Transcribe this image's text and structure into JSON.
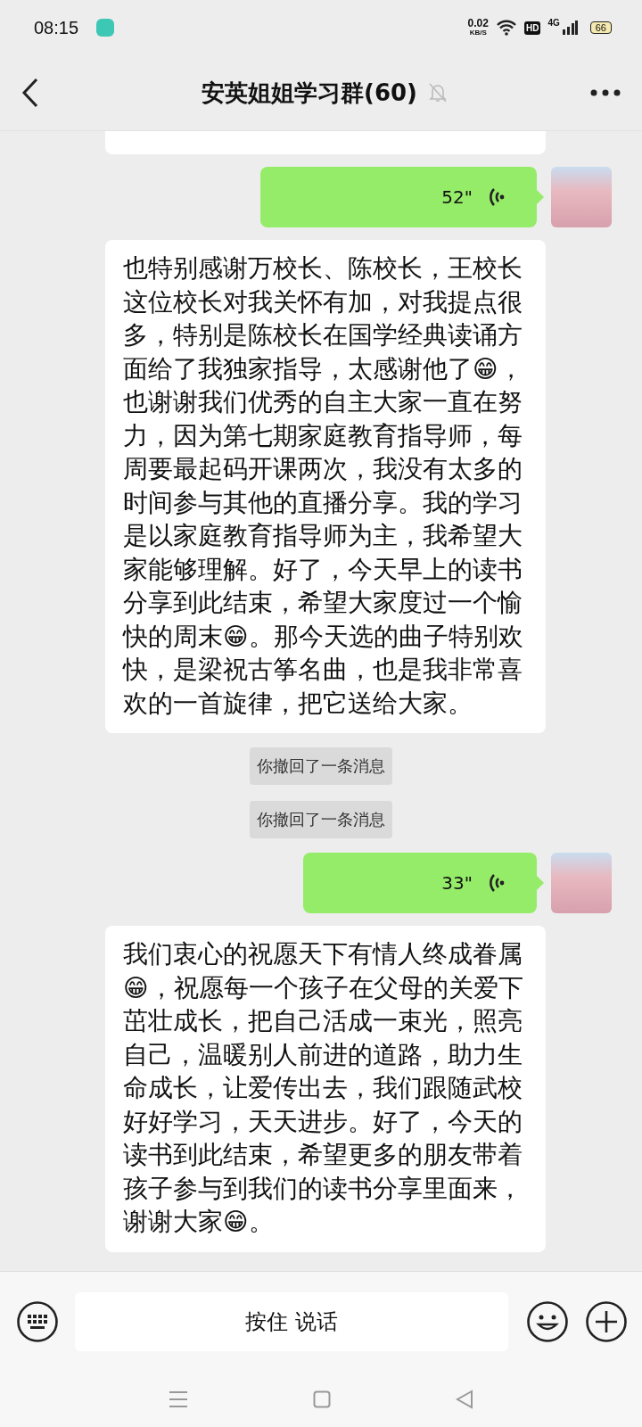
{
  "status_bar": {
    "time": "08:15",
    "net_speed": "0.02",
    "net_unit": "KB/S",
    "hd": "HD",
    "network": "4G",
    "battery": "66"
  },
  "header": {
    "title": "安英姐姐学习群(60)",
    "muted": true
  },
  "messages": [
    {
      "kind": "cut",
      "from_self": false
    },
    {
      "kind": "voice",
      "from_self": true,
      "duration": "52\""
    },
    {
      "kind": "text",
      "from_self": false,
      "text": "也特别感谢万校长、陈校长，王校长这位校长对我关怀有加，对我提点很多，特别是陈校长在国学经典读诵方面给了我独家指导，太感谢他了😁，也谢谢我们优秀的自主大家一直在努力，因为第七期家庭教育指导师，每周要最起码开课两次，我没有太多的时间参与其他的直播分享。我的学习是以家庭教育指导师为主，我希望大家能够理解。好了，今天早上的读书分享到此结束，希望大家度过一个愉快的周末😁。那今天选的曲子特别欢快，是梁祝古筝名曲，也是我非常喜欢的一首旋律，把它送给大家。"
    },
    {
      "kind": "recall",
      "text": "你撤回了一条消息"
    },
    {
      "kind": "recall",
      "text": "你撤回了一条消息"
    },
    {
      "kind": "voice",
      "from_self": true,
      "duration": "33\""
    },
    {
      "kind": "text",
      "from_self": false,
      "text": "我们衷心的祝愿天下有情人终成眷属😁，祝愿每一个孩子在父母的关爱下茁壮成长，把自己活成一束光，照亮自己，温暖别人前进的道路，助力生命成长，让爱传出去，我们跟随武校好好学习，天天进步。好了，今天的读书到此结束，希望更多的朋友带着孩子参与到我们的读书分享里面来，谢谢大家😁。"
    }
  ],
  "footer": {
    "hold_to_talk": "按住 说话"
  }
}
